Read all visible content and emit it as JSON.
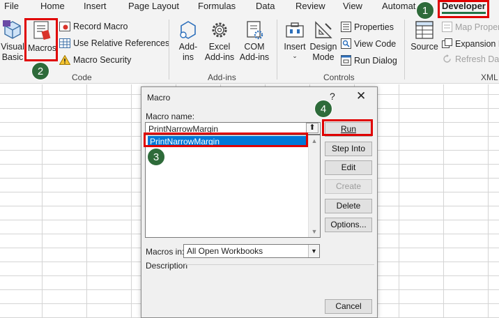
{
  "ribbon": {
    "tabs": [
      "File",
      "Home",
      "Insert",
      "Page Layout",
      "Formulas",
      "Data",
      "Review",
      "View",
      "Automat",
      "Developer"
    ],
    "code_group": {
      "visual_basic": "Visual\nBasic",
      "macros": "Macros",
      "record_macro": "Record Macro",
      "use_relative_references": "Use Relative References",
      "macro_security": "Macro Security",
      "label": "Code"
    },
    "addins_group": {
      "addins": "Add-\nins",
      "excel_addins": "Excel\nAdd-ins",
      "com_addins": "COM\nAdd-ins",
      "label": "Add-ins"
    },
    "controls_group": {
      "insert": "Insert",
      "design_mode": "Design\nMode",
      "properties": "Properties",
      "view_code": "View Code",
      "run_dialog": "Run Dialog",
      "label": "Controls"
    },
    "xml_group": {
      "source": "Source",
      "map_properties": "Map Proper",
      "expansion_packs": "Expansion P",
      "refresh_data": "Refresh Data",
      "label": "XML"
    }
  },
  "badges": [
    "1",
    "2",
    "3",
    "4"
  ],
  "dialog": {
    "title": "Macro",
    "help": "?",
    "close": "✕",
    "macro_name_label": "Macro name:",
    "macro_name_value": "PrintNarrowMargin",
    "macro_list": [
      "PrintNarrowMargin"
    ],
    "buttons": {
      "run": "Run",
      "step_into": "Step Into",
      "edit": "Edit",
      "create": "Create",
      "delete": "Delete",
      "options": "Options...",
      "cancel": "Cancel"
    },
    "macros_in_label": "Macros in:",
    "macros_in_value": "All Open Workbooks",
    "description_label": "Description"
  },
  "colors": {
    "highlight": "#e00000",
    "badge": "#2e6b3a",
    "selection": "#0078d7",
    "excel_green": "#217346"
  }
}
